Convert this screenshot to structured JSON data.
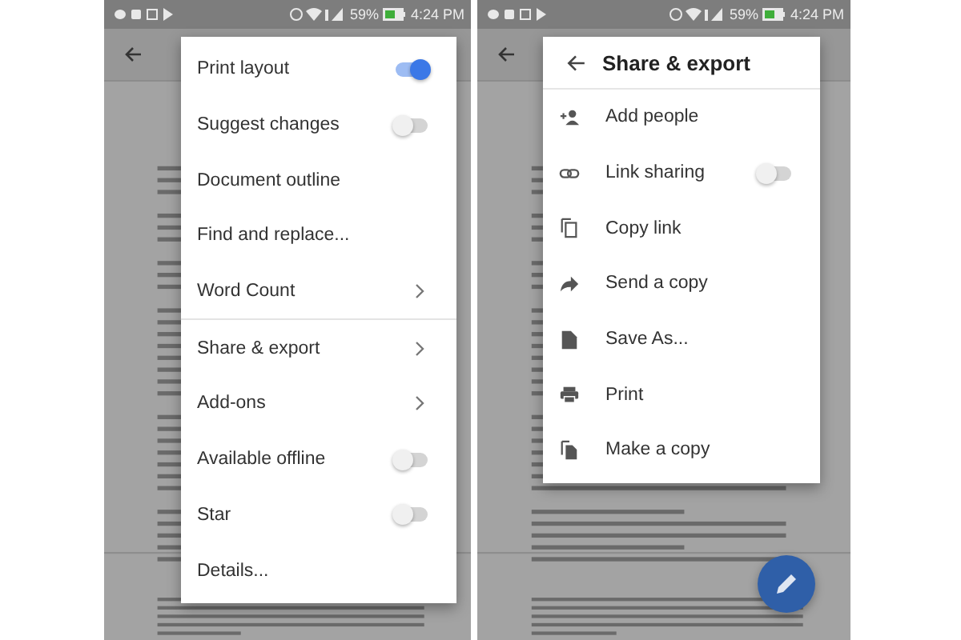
{
  "screens": [
    {
      "status_bar": {
        "battery": "59%",
        "time": "4:24 PM"
      },
      "menu": {
        "sections": [
          [
            {
              "label": "Print layout",
              "kind": "toggle",
              "on": true
            },
            {
              "label": "Suggest changes",
              "kind": "toggle",
              "on": false
            },
            {
              "label": "Document outline",
              "kind": "plain"
            },
            {
              "label": "Find and replace...",
              "kind": "plain"
            },
            {
              "label": "Word Count",
              "kind": "submenu"
            }
          ],
          [
            {
              "label": "Share & export",
              "kind": "submenu"
            },
            {
              "label": "Add-ons",
              "kind": "submenu"
            },
            {
              "label": "Available offline",
              "kind": "toggle",
              "on": false
            },
            {
              "label": "Star",
              "kind": "toggle",
              "on": false
            },
            {
              "label": "Details...",
              "kind": "plain"
            }
          ]
        ]
      }
    },
    {
      "status_bar": {
        "battery": "59%",
        "time": "4:24 PM"
      },
      "menu": {
        "title": "Share & export",
        "sections": [
          [
            {
              "label": "Add people",
              "kind": "plain"
            },
            {
              "label": "Link sharing",
              "kind": "toggle",
              "on": false
            },
            {
              "label": "Copy link",
              "kind": "plain"
            },
            {
              "label": "Send a copy",
              "kind": "plain"
            },
            {
              "label": "Save As...",
              "kind": "plain"
            },
            {
              "label": "Print",
              "kind": "plain"
            },
            {
              "label": "Make a copy",
              "kind": "plain"
            }
          ]
        ]
      },
      "fab": true
    }
  ]
}
